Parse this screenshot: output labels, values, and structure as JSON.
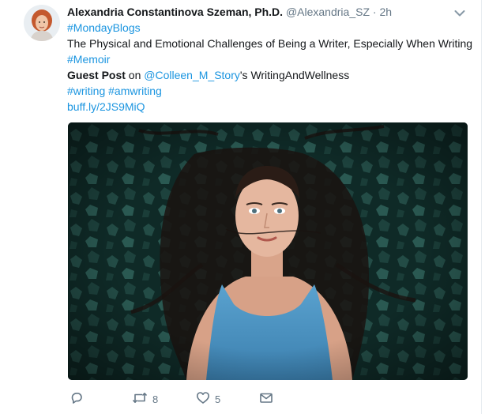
{
  "tweet": {
    "author_name": "Alexandria Constantinova Szeman, Ph.D.",
    "handle": "@Alexandria_SZ",
    "separator": "·",
    "time": "2h",
    "lines": {
      "hashtag1": "#MondayBlogs",
      "title": "The Physical and Emotional Challenges of Being a Writer, Especially When Writing",
      "hashtag2": "#Memoir",
      "guest_post_bold": "Guest Post",
      "on_text": " on ",
      "mention": "@Colleen_M_Story",
      "mention_suffix": "'s WritingAndWellness",
      "hashtag3": "#writing",
      "hashtag4": "#amwriting",
      "link": "buff.ly/2JS9MiQ"
    },
    "actions": {
      "reply_count": "",
      "retweet_count": "8",
      "like_count": "5"
    }
  },
  "colors": {
    "link": "#1b95e0",
    "muted": "#657786",
    "text": "#14171a"
  },
  "icons": [
    "chevron-down-icon",
    "reply-icon",
    "retweet-icon",
    "heart-icon",
    "envelope-icon"
  ]
}
